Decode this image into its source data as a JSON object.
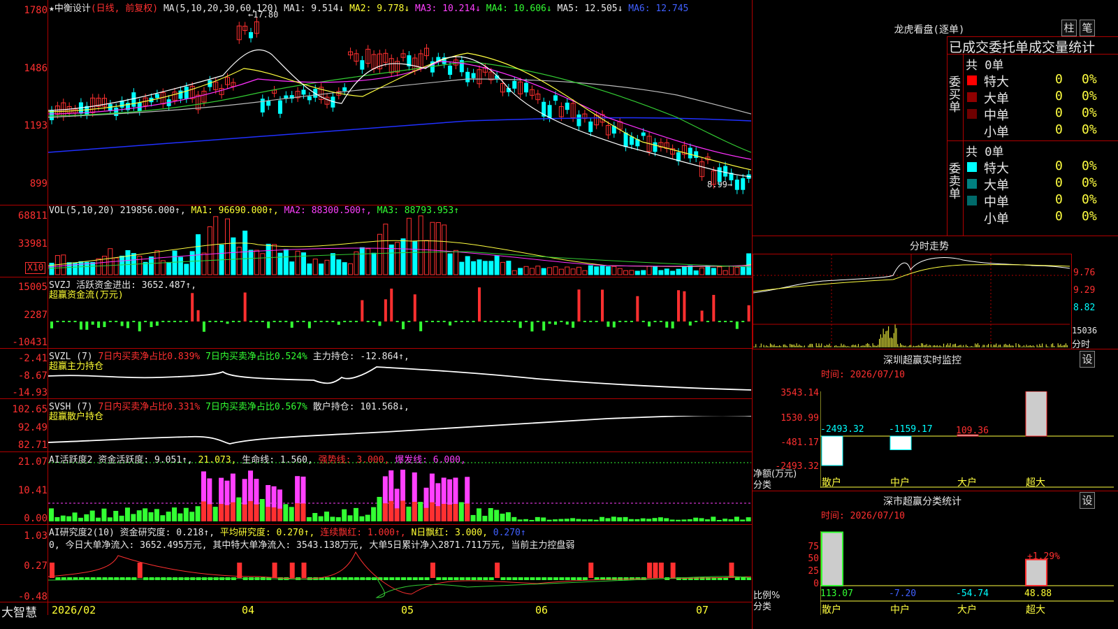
{
  "main_chart": {
    "title": "★中衡设计",
    "mode": "(日线, 前复权)",
    "ma_label": "MA(5,10,20,30,60,120)",
    "ma": [
      {
        "t": "MA1: 9.514↓",
        "c": "#e8e8e8"
      },
      {
        "t": "MA2: 9.778↓",
        "c": "#ffff33"
      },
      {
        "t": "MA3: 10.214↓",
        "c": "#ff40ff"
      },
      {
        "t": "MA4: 10.606↓",
        "c": "#33ff33"
      },
      {
        "t": "MA5: 12.505↓",
        "c": "#e8e8e8"
      },
      {
        "t": "MA6: 12.745",
        "c": "#4060ff"
      }
    ],
    "axis": [
      "1780",
      "1486",
      "1193",
      "899"
    ],
    "high_mark": "←17.80",
    "low_mark": "8.99→"
  },
  "vol_panel": {
    "label": "VOL(5,10,20)",
    "val": "219856.000↑,",
    "ma1": "MA1: 96690.000↑,",
    "ma2": "MA2: 88300.500↑,",
    "ma3": "MA3: 88793.953↑",
    "axis": [
      "68811",
      "33981"
    ],
    "unit": "X10"
  },
  "svzj_panel": {
    "label": "SVZJ",
    "text": "活跃资金进出: 3652.487↑,",
    "sub": "超赢资金流(万元)",
    "axis": [
      "15005",
      "2287",
      "-10431"
    ]
  },
  "svzl_panel": {
    "label": "SVZL (7)",
    "t1": "7日内买卖净占比0.839%",
    "t2": "7日内买卖净占比0.524%",
    "t3": "主力持仓: -12.864↑,",
    "sub": "超赢主力持仓",
    "axis": [
      "-2.41",
      "-8.67",
      "-14.93"
    ]
  },
  "svsh_panel": {
    "label": "SVSH (7)",
    "t1": "7日内买卖净占比0.331%",
    "t2": "7日内买卖净占比0.567%",
    "t3": "散户持仓: 101.568↓,",
    "sub": "超赢散户持仓",
    "axis": [
      "102.65",
      "92.49",
      "82.71"
    ]
  },
  "ai_active": {
    "label": "AI活跃度2",
    "t1": "资金活跃度: 9.051↑,",
    "t2": "21.073,",
    "t3": "生命线: 1.560,",
    "t4": "强势线: 3.000,",
    "t5": "爆发线: 6.000,",
    "axis": [
      "21.07",
      "10.41",
      "0.00"
    ]
  },
  "ai_research": {
    "label": "AI研究度2(10)",
    "t1": "资金研究度: 0.218↑,",
    "t2": "平均研究度: 0.270↑,",
    "t3": "连续飘红: 1.000↑,",
    "t4": "N日飘红: 3.000,",
    "t5": "0.270↑",
    "line2": "0, 今日大单净流入: 3652.495万元, 其中特大单净流入: 3543.138万元, 大单5日累计净入2871.711万元, 当前主力控盘弱",
    "axis": [
      "1.03",
      "0.27",
      "-0.48"
    ]
  },
  "bottom_bar": {
    "brand": "大智慧",
    "dates": [
      "2026/02",
      "04",
      "05",
      "06",
      "07"
    ]
  },
  "lhb": {
    "title": "龙虎看盘(逐单)",
    "btn1": "柱",
    "btn2": "笔",
    "heading": "已成交委托单成交量统计",
    "buy_label": "委买单",
    "sell_label": "委卖单",
    "buy_total": "共 0单",
    "sell_total": "共 0单",
    "buy_rows": [
      {
        "name": "特大",
        "v": "0",
        "p": "0%",
        "c": "#ff0000"
      },
      {
        "name": "大单",
        "v": "0",
        "p": "0%",
        "c": "#900000"
      },
      {
        "name": "中单",
        "v": "0",
        "p": "0%",
        "c": "#700000"
      },
      {
        "name": "小单",
        "v": "0",
        "p": "0%",
        "c": "#000000"
      }
    ],
    "sell_rows": [
      {
        "name": "特大",
        "v": "0",
        "p": "0%",
        "c": "#00ffff"
      },
      {
        "name": "大单",
        "v": "0",
        "p": "0%",
        "c": "#008080"
      },
      {
        "name": "中单",
        "v": "0",
        "p": "0%",
        "c": "#006a6a"
      },
      {
        "name": "小单",
        "v": "0",
        "p": "0%",
        "c": "#000000"
      }
    ]
  },
  "intraday": {
    "title": "分时走势",
    "axis": [
      "9.76",
      "9.29",
      "8.82"
    ],
    "vol_axis": "15036",
    "vol_label": "分时"
  },
  "sz_monitor": {
    "title": "深圳超赢实时监控",
    "btn": "设",
    "time": "时间: 2026/07/10",
    "axis": [
      "3543.14",
      "1530.99",
      "-481.17",
      "-2493.32"
    ],
    "side1": "净额(万元)",
    "side2": "分类",
    "bars": [
      {
        "cat": "散户",
        "val": "-2493.32",
        "c": "#00ffff"
      },
      {
        "cat": "中户",
        "val": "-1159.17",
        "c": "#00ffff"
      },
      {
        "cat": "大户",
        "val": "109.36",
        "c": "#ff3030"
      },
      {
        "cat": "超大",
        "val": "3543.14",
        "c": "#ff3030"
      }
    ]
  },
  "sz_class": {
    "title": "深市超赢分类统计",
    "btn": "设",
    "time": "时间: 2026/07/10",
    "axis": [
      "75",
      "50",
      "25",
      "0"
    ],
    "side1": "比例%",
    "side2": "分类",
    "pct_mark": "+1.29%",
    "bars": [
      {
        "cat": "散户",
        "val": "113.07",
        "c": "#33ff33"
      },
      {
        "cat": "中户",
        "val": "-7.20",
        "c": "#4060ff"
      },
      {
        "cat": "大户",
        "val": "-54.74",
        "c": "#00ffff"
      },
      {
        "cat": "超大",
        "val": "48.88",
        "c": "#ffff33"
      }
    ]
  }
}
